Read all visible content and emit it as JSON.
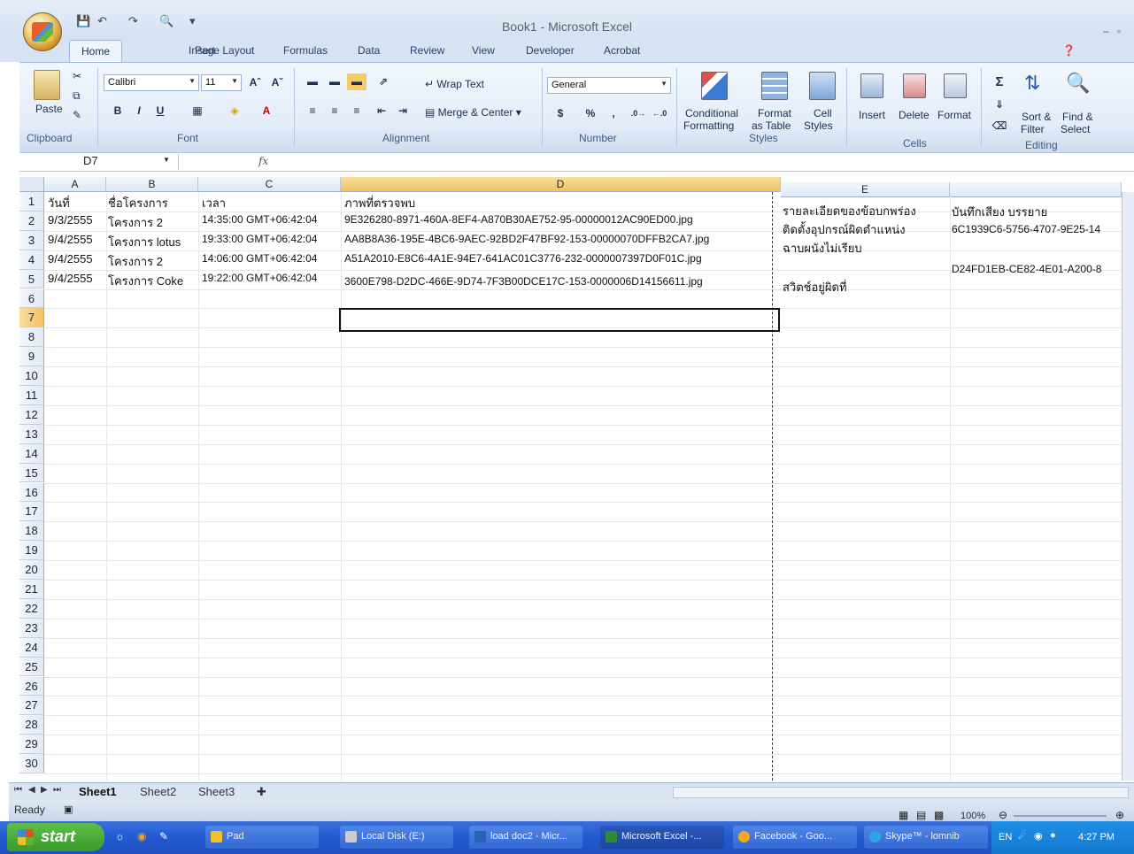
{
  "window": {
    "title": "Book1 - Microsoft Excel"
  },
  "ribbon": {
    "tabs": [
      "Home",
      "Insert",
      "Page Layout",
      "Formulas",
      "Data",
      "Review",
      "View",
      "Developer",
      "Acrobat"
    ],
    "clipboard": {
      "paste": "Paste",
      "label": "Clipboard"
    },
    "font": {
      "name": "Calibri",
      "size": "11",
      "label": "Font"
    },
    "alignment": {
      "wrap": "Wrap Text",
      "merge": "Merge & Center",
      "label": "Alignment"
    },
    "number": {
      "format": "General",
      "currency": "$",
      "percent": "%",
      "comma": ",",
      "label": "Number"
    },
    "styles": {
      "conditional_1": "Conditional",
      "conditional_2": "Formatting",
      "format_table_1": "Format",
      "format_table_2": "as Table",
      "cell_styles_1": "Cell",
      "cell_styles_2": "Styles",
      "label": "Styles"
    },
    "cells": {
      "insert": "Insert",
      "delete": "Delete",
      "format": "Format",
      "label": "Cells"
    },
    "editing": {
      "sort_1": "Sort &",
      "sort_2": "Filter",
      "find_1": "Find &",
      "find_2": "Select",
      "label": "Editing"
    }
  },
  "formula_bar": {
    "name_box": "D7",
    "fx": "fx",
    "value": ""
  },
  "columns": [
    "A",
    "B",
    "C",
    "D",
    "E"
  ],
  "rows": [
    "1",
    "2",
    "3",
    "4",
    "5",
    "6",
    "7",
    "8",
    "9",
    "10",
    "11",
    "12",
    "13",
    "14",
    "15",
    "16",
    "17",
    "18",
    "19",
    "20",
    "21",
    "22",
    "23",
    "24",
    "25",
    "26",
    "27",
    "28",
    "29",
    "30"
  ],
  "cells": {
    "A1": "วันที่",
    "B1": "ชื่อโครงการ",
    "C1": "เวลา",
    "D1": "ภาพที่ตรวจพบ",
    "E1": "รายละเอียดของข้อบกพร่อง",
    "F1": "บันทึกเสียง บรรยาย",
    "A2": "9/3/2555",
    "B2": "โครงการ 2",
    "C2": "14:35:00 GMT+06:42:04",
    "D2": "9E326280-8971-460A-8EF4-A870B30AE752-95-00000012AC90ED00.jpg",
    "E2": "ติดตั้งอุปกรณ์ผิดตำแหน่ง",
    "F2": "6C1939C6-5756-4707-9E25-14",
    "A3": "9/4/2555",
    "B3": "โครงการ lotus",
    "C3": "19:33:00 GMT+06:42:04",
    "D3": "AA8B8A36-195E-4BC6-9AEC-92BD2F47BF92-153-00000070DFFB2CA7.jpg",
    "E3": "ฉาบผนังไม่เรียบ",
    "A4": "9/4/2555",
    "B4": "โครงการ 2",
    "C4": "14:06:00 GMT+06:42:04",
    "D4": "A51A2010-E8C6-4A1E-94E7-641AC01C3776-232-0000007397D0F01C.jpg",
    "F4": "D24FD1EB-CE82-4E01-A200-8",
    "A5": "9/4/2555",
    "B5": "โครงการ Coke",
    "C5": "19:22:00 GMT+06:42:04",
    "D5": "3600E798-D2DC-466E-9D74-7F3B00DCE17C-153-0000006D14156611.jpg",
    "E5": "สวิตช์อยู่ผิดที่"
  },
  "sheets": [
    "Sheet1",
    "Sheet2",
    "Sheet3"
  ],
  "status": {
    "text": "Ready",
    "zoom": "100%"
  },
  "taskbar": {
    "start": "start",
    "items": [
      "Pad",
      "Local Disk (E:)",
      "load doc2 - Micr...",
      "Microsoft Excel -...",
      "Facebook - Goo...",
      "Skype™ - lomnib"
    ],
    "lang": "EN",
    "clock": "4:27 PM"
  }
}
